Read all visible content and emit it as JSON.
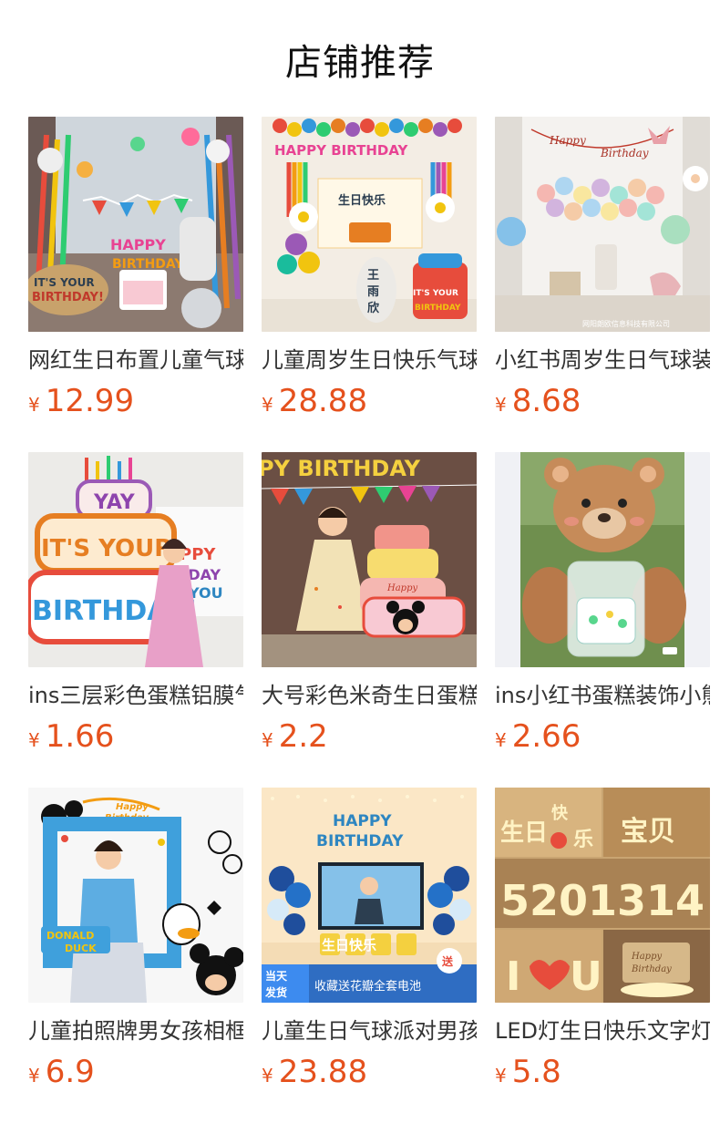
{
  "section": {
    "title": "店铺推荐"
  },
  "products": [
    {
      "name": "网红生日布置儿童气球",
      "currency": "¥",
      "price": "12.99",
      "image_icon": "birthday-room-photo",
      "image_texts": [
        "IT'S YOUR BIRTHDAY!",
        "HAPPY BIRTHDAY"
      ]
    },
    {
      "name": "儿童周岁生日快乐气球",
      "currency": "¥",
      "price": "28.88",
      "image_icon": "birthday-wall-photo",
      "image_texts": [
        "HAPPY BIRTHDAY",
        "生日快乐",
        "王雨欣",
        "IT'S YOUR BIRTHDAY"
      ]
    },
    {
      "name": "小红书周岁生日气球装饰",
      "currency": "¥",
      "price": "8.68",
      "image_icon": "balloon-room-photo",
      "image_texts": [
        "Happy Birthday",
        "网阳朗欧信息科技有限公司"
      ]
    },
    {
      "name": "ins三层彩色蛋糕铝膜气球",
      "currency": "¥",
      "price": "1.66",
      "image_icon": "cake-balloon-photo",
      "image_texts": [
        "YAY",
        "IT'S YOUR",
        "BIRTHDAY!",
        "HAPPY BIRTHDAY YOU"
      ]
    },
    {
      "name": "大号彩色米奇生日蛋糕气球",
      "currency": "¥",
      "price": "2.2",
      "image_icon": "mickey-cake-photo",
      "image_texts": [
        "HAPPY BIRTHDAY",
        "Happy"
      ]
    },
    {
      "name": "ins小红书蛋糕装饰小熊气球",
      "currency": "¥",
      "price": "2.66",
      "image_icon": "bear-balloon-photo",
      "image_texts": []
    },
    {
      "name": "儿童拍照牌男女孩相框",
      "currency": "¥",
      "price": "6.9",
      "image_icon": "photo-frame-photo",
      "image_texts": [
        "DONALD DUCK",
        "Happy Birthday"
      ]
    },
    {
      "name": "儿童生日气球派对男孩装饰",
      "currency": "¥",
      "price": "23.88",
      "image_icon": "party-set-photo",
      "image_texts": [
        "HAPPY BIRTHDAY",
        "生日快乐",
        "当天发货",
        "收藏送花瓣全套电池",
        "送"
      ]
    },
    {
      "name": "LED灯生日快乐文字灯",
      "currency": "¥",
      "price": "5.8",
      "image_icon": "led-letters-photo",
      "image_texts": [
        "生日快乐",
        "宝贝",
        "5201314",
        "I ♥ U",
        "Happy Birthday"
      ]
    }
  ]
}
